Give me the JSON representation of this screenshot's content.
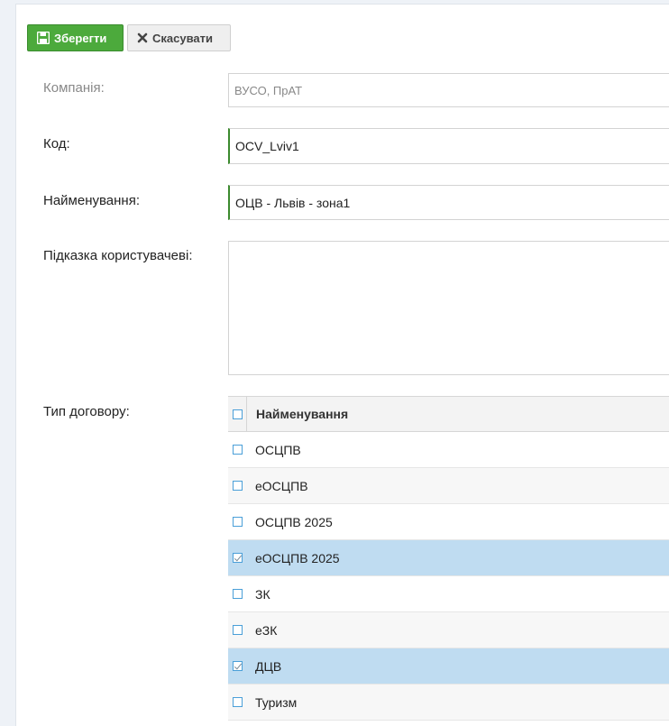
{
  "toolbar": {
    "save_label": "Зберегти",
    "cancel_label": "Скасувати"
  },
  "form": {
    "company": {
      "label": "Компанія:",
      "value": "ВУСО, ПрАТ"
    },
    "code": {
      "label": "Код:",
      "value": "OCV_Lviv1"
    },
    "name": {
      "label": "Найменування:",
      "value": "ОЦВ - Львів - зона1"
    },
    "hint": {
      "label": "Підказка користувачеві:",
      "value": ""
    },
    "contract_type": {
      "label": "Тип договору:",
      "column_header": "Найменування",
      "rows": [
        {
          "name": "ОСЦПВ",
          "checked": false
        },
        {
          "name": "еОСЦПВ",
          "checked": false
        },
        {
          "name": "ОСЦПВ 2025",
          "checked": false
        },
        {
          "name": "еОСЦПВ 2025",
          "checked": true
        },
        {
          "name": "ЗК",
          "checked": false
        },
        {
          "name": "еЗК",
          "checked": false
        },
        {
          "name": "ДЦВ",
          "checked": true
        },
        {
          "name": "Туризм",
          "checked": false
        }
      ]
    }
  },
  "colors": {
    "save_button": "#4caa3c",
    "selected_row": "#bfdcf1",
    "checkbox_border": "#4a9fd8"
  }
}
